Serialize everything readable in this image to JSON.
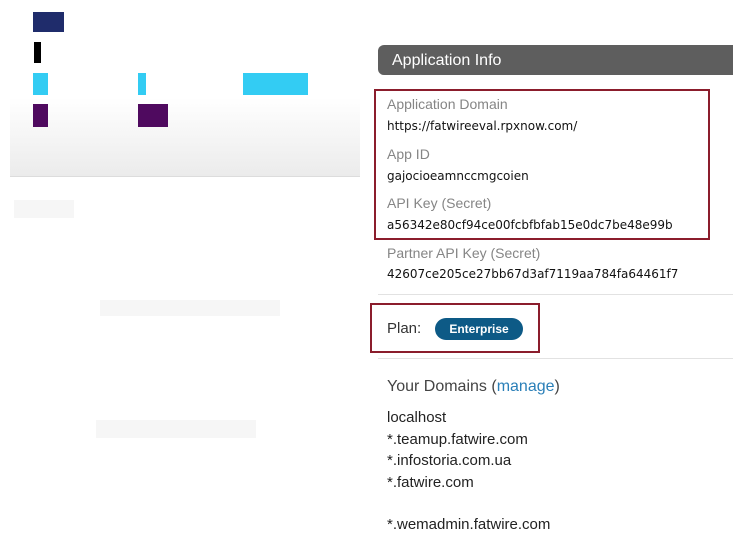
{
  "colors": {
    "navy": "#1f2c6b",
    "black": "#000000",
    "cyan": "#33ccf3",
    "purple": "#4f0a5f",
    "header_bg": "#5e5e5e",
    "badge_bg": "#0d5a86",
    "highlight_border": "#8b1d2c",
    "link": "#2a7fb8"
  },
  "app_info": {
    "header": "Application Info",
    "application_domain_label": "Application Domain",
    "application_domain_value": "https://fatwireeval.rpxnow.com/",
    "app_id_label": "App ID",
    "app_id_value": "gajocioeamnccmgcoien",
    "api_key_label": "API Key (Secret)",
    "api_key_value": "a56342e80cf94ce00fcbfbfab15e0dc7be48e99b",
    "partner_api_key_label": "Partner API Key (Secret)",
    "partner_api_key_value": "42607ce205ce27bb67d3af7119aa784fa64461f7"
  },
  "plan": {
    "label": "Plan:",
    "value": "Enterprise"
  },
  "domains": {
    "title": "Your Domains",
    "open_paren": "(",
    "manage_link": "manage",
    "close_paren": ")",
    "items": [
      "localhost",
      "*.teamup.fatwire.com",
      "*.infostoria.com.ua",
      "*.fatwire.com",
      "*.wemadmin.fatwire.com"
    ]
  }
}
